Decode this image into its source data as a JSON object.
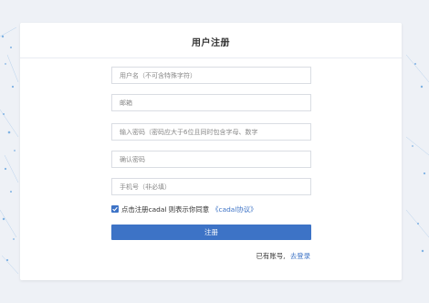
{
  "form": {
    "title": "用户注册",
    "fields": [
      {
        "placeholder": "用户名（不可含特殊字符）",
        "value": ""
      },
      {
        "placeholder": "邮箱",
        "value": ""
      },
      {
        "placeholder": "输入密码（密码应大于6位且同时包含字母、数字",
        "value": ""
      },
      {
        "placeholder": "确认密码",
        "value": ""
      },
      {
        "placeholder": "手机号（非必填）",
        "value": ""
      }
    ],
    "agree_checked": true,
    "agree_text": "点击注册cadal 则表示你同意",
    "agree_link": "《cadal协议》",
    "submit_label": "注册",
    "has_account_text": "已有账号,",
    "login_link": "去登录"
  },
  "colors": {
    "accent": "#3d73c6",
    "background": "#eef1f6",
    "network_dots": "#7fb2e3"
  }
}
